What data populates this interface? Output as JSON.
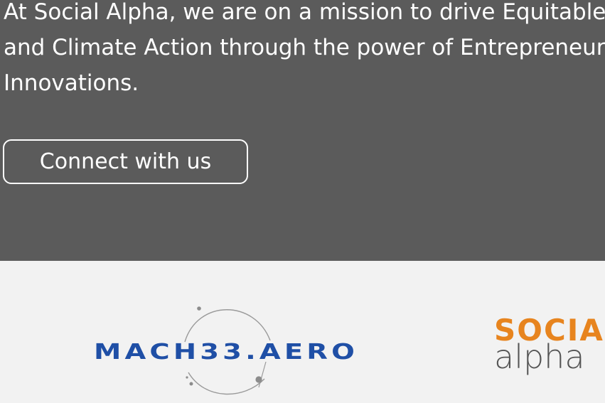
{
  "hero": {
    "mission_lines": [
      "At Social Alpha, we are on a mission to drive Equitable Development",
      "and Climate Action through the power of Entrepreneurial",
      "Innovations."
    ],
    "cta_label": "Connect with us"
  },
  "partners": {
    "mach33_logo_text": "MACH33.AERO",
    "social_alpha_logo": {
      "top_word": "SOCIAL",
      "bottom_word": "alpha"
    }
  },
  "colors": {
    "hero_background": "#5b5b5b",
    "page_background": "#f2f2f2",
    "mach33_blue": "#1f4fa6",
    "social_orange": "#e7841e",
    "alpha_gray": "#555555"
  }
}
